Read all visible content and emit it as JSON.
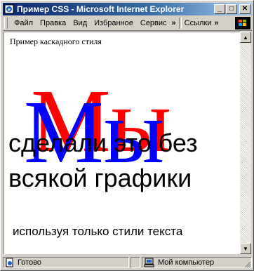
{
  "window": {
    "title": "Пример CSS - Microsoft Internet Explorer",
    "minimize_glyph": "_",
    "maximize_glyph": "□",
    "close_glyph": "✕"
  },
  "menu": {
    "items": [
      "Файл",
      "Правка",
      "Вид",
      "Избранное",
      "Сервис"
    ],
    "more_glyph": "»",
    "links_label": "Ссылки",
    "links_more_glyph": "»"
  },
  "page": {
    "heading": "Пример каскадного стиля",
    "big_red": "Мы",
    "big_blue": "Мы",
    "line1": "сделали это без",
    "line2": "всякой графики",
    "footer": "используя только стили текста"
  },
  "scrollbar": {
    "up_glyph": "▲",
    "down_glyph": "▼"
  },
  "status": {
    "left_text": "Готово",
    "right_text": "Мой компьютер"
  },
  "colors": {
    "title_gradient_start": "#0a246a",
    "big_red": "#ff0000",
    "big_blue": "#0000ff",
    "chrome": "#d4d0c8"
  },
  "icons": {
    "app": "ie-page-icon",
    "logo": "windows-logo-icon",
    "status_page": "page-done-icon",
    "status_computer": "my-computer-icon"
  }
}
